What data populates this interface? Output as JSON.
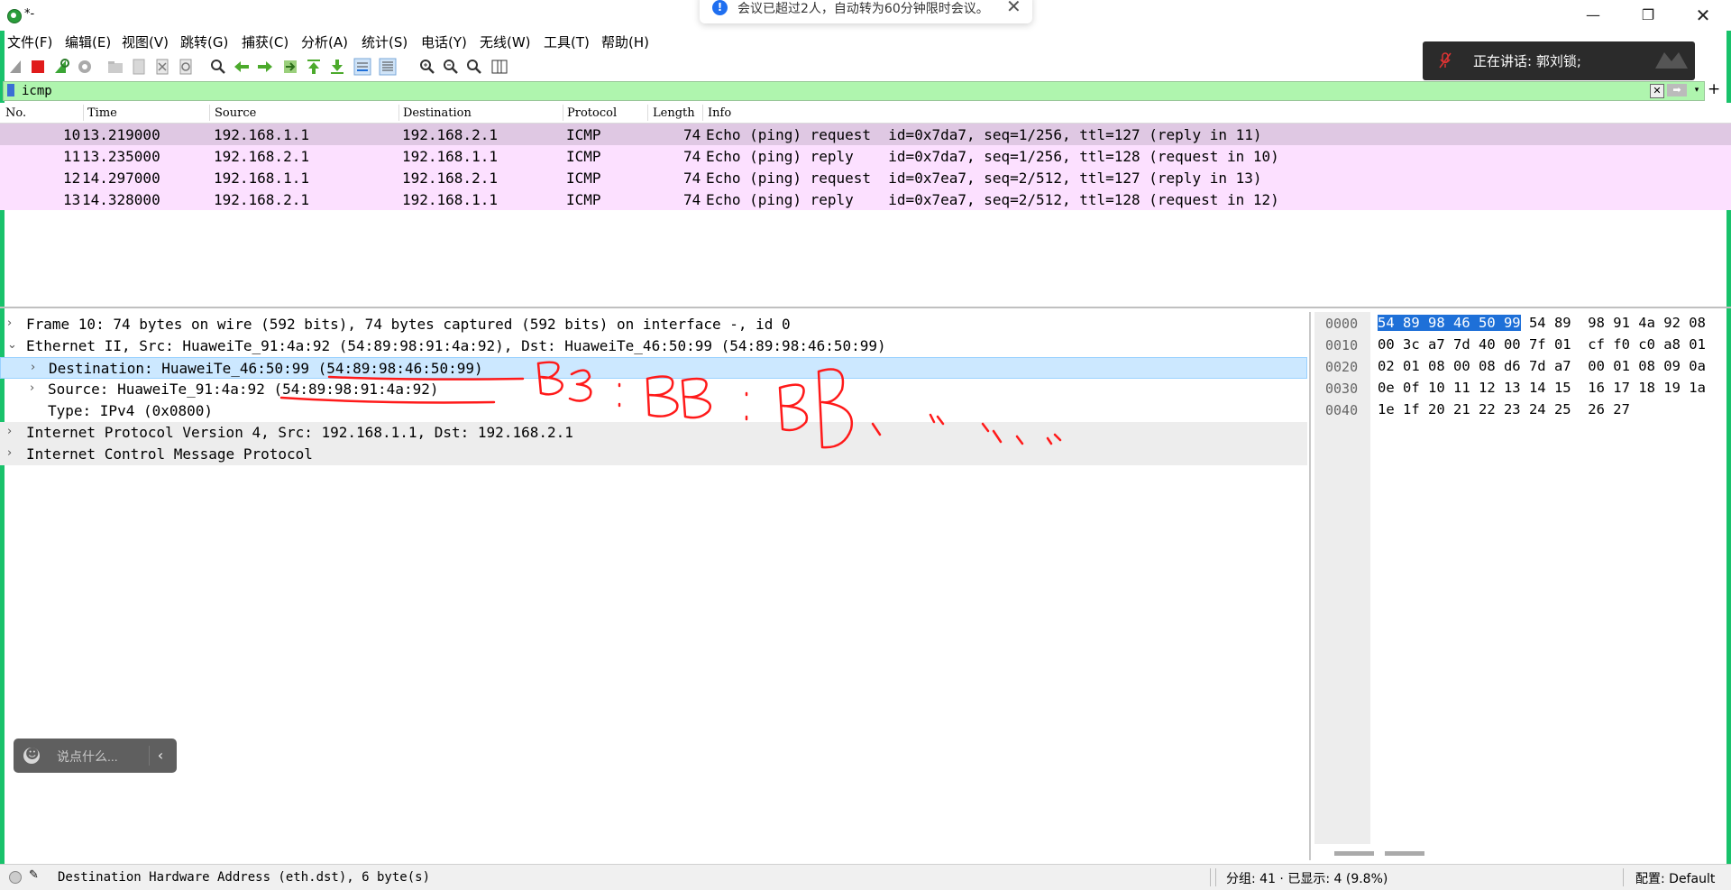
{
  "window": {
    "title": "*-",
    "minimize_icon": "minimize-icon",
    "maximize_icon": "restore-icon",
    "close_icon": "close-icon"
  },
  "notification": {
    "text": "会议已超过2人，自动转为60分钟限时会议。",
    "icon": "info-icon",
    "accent": "#1f6ff0"
  },
  "menubar": {
    "items": [
      "文件(F)",
      "编辑(E)",
      "视图(V)",
      "跳转(G)",
      "捕获(C)",
      "分析(A)",
      "统计(S)",
      "电话(Y)",
      "无线(W)",
      "工具(T)",
      "帮助(H)"
    ]
  },
  "speaking_overlay": {
    "label": "正在讲话:  郭刘锁;"
  },
  "filter": {
    "value": "icmp",
    "background": "#aff5ae"
  },
  "packet_list": {
    "columns": [
      "No.",
      "Time",
      "Source",
      "Destination",
      "Protocol",
      "Length",
      "Info"
    ],
    "rows": [
      {
        "no": "10",
        "time": "13.219000",
        "source": "192.168.1.1",
        "destination": "192.168.2.1",
        "protocol": "ICMP",
        "length": "74",
        "info": "Echo (ping) request  id=0x7da7, seq=1/256, ttl=127 (reply in 11)"
      },
      {
        "no": "11",
        "time": "13.235000",
        "source": "192.168.2.1",
        "destination": "192.168.1.1",
        "protocol": "ICMP",
        "length": "74",
        "info": "Echo (ping) reply    id=0x7da7, seq=1/256, ttl=128 (request in 10)"
      },
      {
        "no": "12",
        "time": "14.297000",
        "source": "192.168.1.1",
        "destination": "192.168.2.1",
        "protocol": "ICMP",
        "length": "74",
        "info": "Echo (ping) request  id=0x7ea7, seq=2/512, ttl=127 (reply in 13)"
      },
      {
        "no": "13",
        "time": "14.328000",
        "source": "192.168.2.1",
        "destination": "192.168.1.1",
        "protocol": "ICMP",
        "length": "74",
        "info": "Echo (ping) reply    id=0x7ea7, seq=2/512, ttl=128 (request in 12)"
      }
    ],
    "row_color": "#fce0ff",
    "selected_row_color": "#dfc8e3"
  },
  "details": {
    "rows": [
      {
        "arrow": "›",
        "text": "Frame 10: 74 bytes on wire (592 bits), 74 bytes captured (592 bits) on interface -, id 0"
      },
      {
        "arrow": "⌄",
        "text": "Ethernet II, Src: HuaweiTe_91:4a:92 (54:89:98:91:4a:92), Dst: HuaweiTe_46:50:99 (54:89:98:46:50:99)"
      },
      {
        "arrow": "›",
        "text": "Destination: HuaweiTe_46:50:99 (54:89:98:46:50:99)"
      },
      {
        "arrow": "›",
        "text": "Source: HuaweiTe_91:4a:92 (54:89:98:91:4a:92)"
      },
      {
        "arrow": "",
        "text": "Type: IPv4 (0x0800)"
      },
      {
        "arrow": "›",
        "text": "Internet Protocol Version 4, Src: 192.168.1.1, Dst: 192.168.2.1"
      },
      {
        "arrow": "›",
        "text": "Internet Control Message Protocol"
      }
    ],
    "selected_color": "#cce8ff"
  },
  "bytes": {
    "offsets": [
      "0000",
      "0010",
      "0020",
      "0030",
      "0040"
    ],
    "highlight": "54 89 98 46 50 99",
    "line0_rest": " 54 89  98 91 4a 92 08",
    "lines": [
      "00 3c a7 7d 40 00 7f 01  cf f0 c0 a8 01",
      "02 01 08 00 08 d6 7d a7  00 01 08 09 0a",
      "0e 0f 10 11 12 13 14 15  16 17 18 19 1a",
      "1e 1f 20 21 22 23 24 25  26 27"
    ],
    "highlight_color": "#1e70d8"
  },
  "annotation": {
    "color": "#ff1a1a"
  },
  "chat": {
    "placeholder": "说点什么...",
    "collapse": "‹"
  },
  "statusbar": {
    "field_info": "Destination Hardware Address (eth.dst), 6 byte(s)",
    "packets": "分组: 41 · 已显示: 4 (9.8%)",
    "profile": "配置: Default"
  }
}
